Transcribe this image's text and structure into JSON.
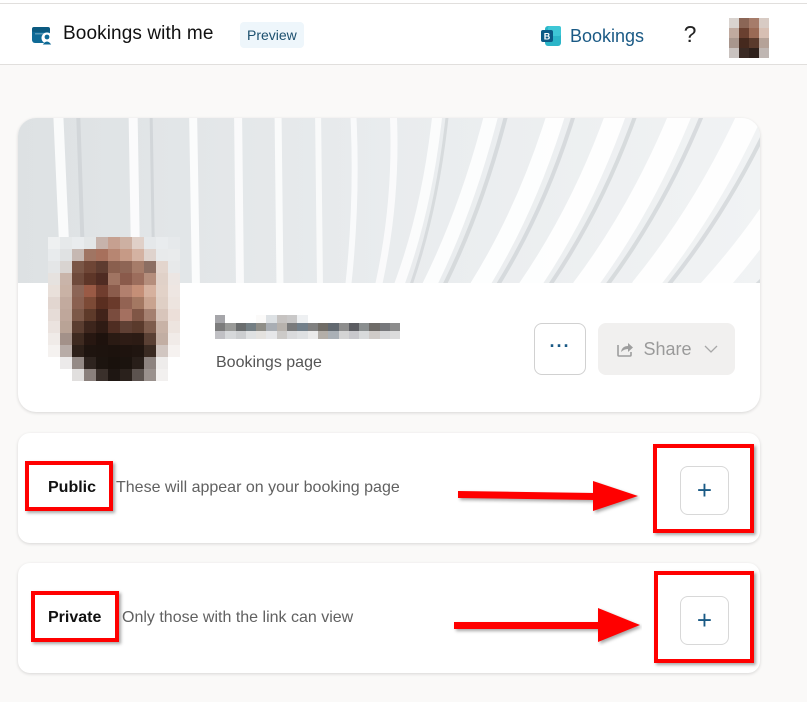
{
  "header": {
    "app_icon": "calendar-person-icon",
    "title": "Bookings with me",
    "badge": "Preview",
    "bookings_link": {
      "icon": "bookings-logo-icon",
      "label": "Bookings"
    },
    "help": {
      "icon": "question-mark-icon",
      "label": "?"
    },
    "avatar": "user-avatar-pixelated"
  },
  "profile": {
    "banner": "abstract-white-curves-image",
    "avatar": "profile-photo-pixelated",
    "name_redacted": true,
    "subtitle": "Bookings page",
    "more_button": {
      "icon": "more-horizontal-icon",
      "label": "···"
    },
    "share_button": {
      "icon": "share-icon",
      "label": "Share",
      "chevron": "chevron-down-icon",
      "disabled": true
    }
  },
  "sections": [
    {
      "id": "public",
      "title": "Public",
      "description": "These will appear on your booking page",
      "add_label": "+"
    },
    {
      "id": "private",
      "title": "Private",
      "description": "Only those with the link can view",
      "add_label": "+"
    }
  ],
  "annotations": {
    "color": "#ff0000",
    "items": [
      "highlight-public-label",
      "highlight-public-add",
      "highlight-private-label",
      "highlight-private-add",
      "arrow-to-public-add",
      "arrow-to-private-add"
    ]
  },
  "colors": {
    "accent": "#1a5a85",
    "background": "#faf9f8",
    "annotation": "#ff0000"
  }
}
